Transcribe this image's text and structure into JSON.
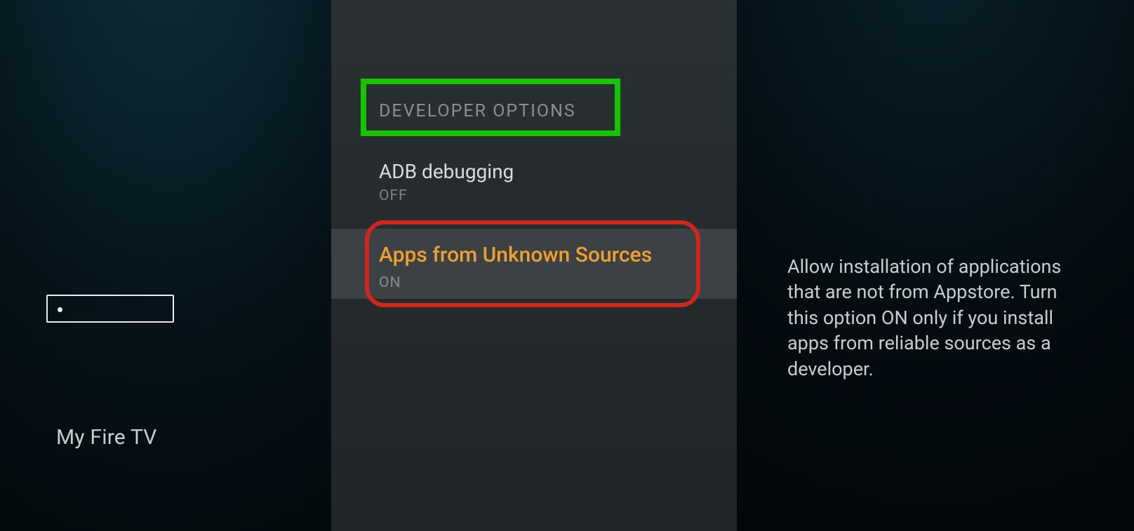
{
  "left": {
    "section_label": "My Fire TV"
  },
  "middle": {
    "header": "DEVELOPER OPTIONS",
    "options": {
      "adb": {
        "title": "ADB debugging",
        "state": "OFF"
      },
      "unknown": {
        "title": "Apps from Unknown Sources",
        "state": "ON"
      }
    }
  },
  "right": {
    "description": "Allow installation of applications that are not from Appstore. Turn this option ON only if you install apps from reliable sources as a developer."
  },
  "annotations": {
    "green_box": "highlight-developer-options",
    "red_box": "highlight-apps-from-unknown-sources"
  }
}
